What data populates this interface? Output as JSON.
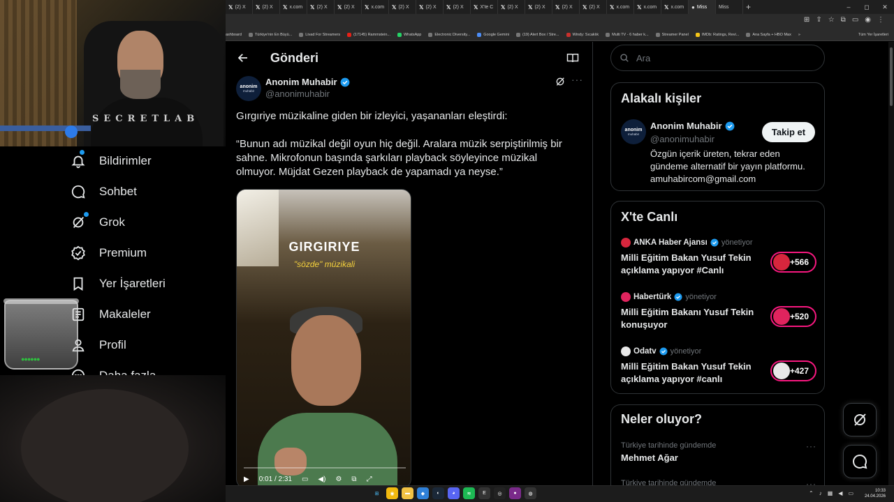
{
  "browser": {
    "tabs": [
      {
        "icon": "x",
        "label": "(2) X"
      },
      {
        "icon": "x",
        "label": "(2) X"
      },
      {
        "icon": "x",
        "label": "x.com"
      },
      {
        "icon": "x",
        "label": "(2) X"
      },
      {
        "icon": "x",
        "label": "(2) X"
      },
      {
        "icon": "x",
        "label": "x.com"
      },
      {
        "icon": "x",
        "label": "(2) X"
      },
      {
        "icon": "x",
        "label": "(2) X"
      },
      {
        "icon": "x",
        "label": "(2) X"
      },
      {
        "icon": "x",
        "label": "X'te C"
      },
      {
        "icon": "x",
        "label": "(2) X"
      },
      {
        "icon": "x",
        "label": "(2) X"
      },
      {
        "icon": "x",
        "label": "(2) X"
      },
      {
        "icon": "x",
        "label": "(2) X"
      },
      {
        "icon": "x",
        "label": "x.com"
      },
      {
        "icon": "x",
        "label": "x.com"
      },
      {
        "icon": "x",
        "label": "x.com"
      },
      {
        "icon": "globe",
        "label": "Miss"
      },
      {
        "icon": "",
        "label": "Miss"
      }
    ],
    "new_tab": "+",
    "window_controls": [
      "–",
      "◻",
      "✕"
    ],
    "bookmarks": [
      "ashboard",
      "Türkiye'nin En Büyü...",
      "Livad For Streamers",
      "(17145) Rammstein...",
      "WhatsApp",
      "Electronic Diversity...",
      "Google Gemini",
      "(19) Alert Box / Stre...",
      "Windy: Sıcaklık",
      "Multi TV - 6 haber k...",
      "Streamer Panel",
      "IMDb: Ratings, Revi...",
      "Ana Sayfa + HBO Max",
      "»"
    ],
    "bookmarks_all": "Tüm Yer İşaretleri"
  },
  "webcam": {
    "brand_text": "SECRETLAB"
  },
  "nav": {
    "items": [
      {
        "label": "Bildirimler",
        "icon": "bell-icon"
      },
      {
        "label": "Sohbet",
        "icon": "chat-icon"
      },
      {
        "label": "Grok",
        "icon": "grok-icon"
      },
      {
        "label": "Premium",
        "icon": "premium-icon"
      },
      {
        "label": "Yer İşaretleri",
        "icon": "bookmark-icon"
      },
      {
        "label": "Makaleler",
        "icon": "article-icon"
      },
      {
        "label": "Profil",
        "icon": "profile-icon"
      },
      {
        "label": "Daha fazla",
        "icon": "more-icon"
      }
    ]
  },
  "main": {
    "title": "Gönderi",
    "post": {
      "avatar_line1": "anonim",
      "avatar_line2": "muhabir",
      "author_name": "Anonim Muhabir",
      "author_handle": "@anonimuhabir",
      "text1": "Gırgıriye müzikaline giden bir izleyici, yaşananları eleştirdi:",
      "text2": "“Bunun adı müzikal değil oyun hiç değil. Aralara müzik serpiştirilmiş bir sahne. Mikrofonun başında şarkıları playback söyleyince müzikal olmuyor. Müjdat Gezen playback de yapamadı ya neyse.”",
      "video": {
        "title": "GIRGIRIYE",
        "subtitle": "\"sözde\" müzikali",
        "time": "0:01 / 2:31"
      }
    }
  },
  "search": {
    "placeholder": "Ara"
  },
  "related": {
    "title": "Alakalı kişiler",
    "name": "Anonim Muhabir",
    "handle": "@anonimuhabir",
    "follow_label": "Takip et",
    "bio": "Özgün içerik üreten, tekrar eden gündeme alternatif bir yayın platformu. amuhabircom@gmail.com",
    "avatar_line1": "anonim",
    "avatar_line2": "muhabir"
  },
  "live": {
    "title": "X'te Canlı",
    "items": [
      {
        "source": "ANKA Haber Ajansı",
        "role": "yönetiyor",
        "title": "Milli Eğitim Bakan Yusuf Tekin açıklama yapıyor #Canlı",
        "count": "+566",
        "color": "#d7263d"
      },
      {
        "source": "Habertürk",
        "role": "yönetiyor",
        "title": "Milli Eğitim Bakanı Yusuf Tekin konuşuyor",
        "count": "+520",
        "color": "#e0245e"
      },
      {
        "source": "Odatv",
        "role": "yönetiyor",
        "title": "Milli Eğitim Bakan Yusuf Tekin açıklama yapıyor #canlı",
        "count": "+427",
        "color": "#e8e8e8"
      }
    ]
  },
  "trends": {
    "title": "Neler oluyor?",
    "items": [
      {
        "context": "Türkiye tarihinde gündemde",
        "name": "Mehmet Ağar"
      },
      {
        "context": "Türkiye tarihinde gündemde",
        "name": ""
      }
    ]
  },
  "taskbar": {
    "time": "10:33",
    "date": "24.04.2026"
  },
  "colors": {
    "accent": "#1d9bf0",
    "live": "#f91880",
    "background": "#000000",
    "muted": "#71767b"
  }
}
